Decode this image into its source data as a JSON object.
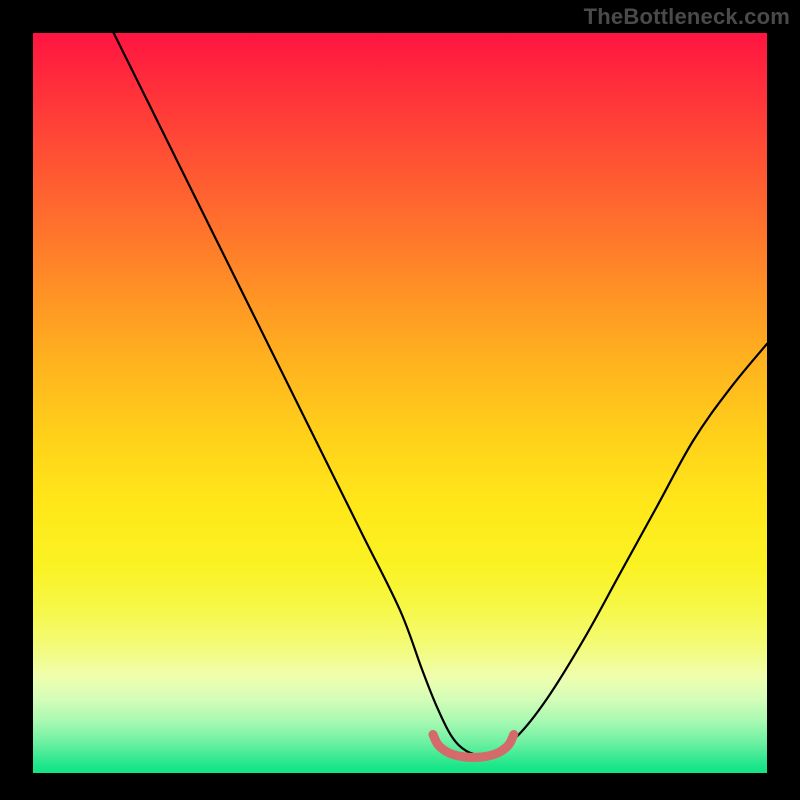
{
  "watermark": "TheBottleneck.com",
  "chart_data": {
    "type": "line",
    "title": "",
    "xlabel": "",
    "ylabel": "",
    "xlim": [
      0,
      100
    ],
    "ylim": [
      0,
      100
    ],
    "grid": false,
    "series": [
      {
        "name": "bottleneck-curve",
        "color": "#000000",
        "x": [
          11,
          15,
          20,
          25,
          30,
          35,
          40,
          45,
          50,
          53,
          55,
          57,
          59,
          61,
          63,
          66,
          70,
          75,
          80,
          85,
          90,
          95,
          100
        ],
        "y": [
          100,
          92,
          82,
          72,
          62,
          52,
          42,
          32,
          22,
          14,
          9,
          5,
          3,
          2.5,
          3,
          5,
          10,
          18,
          27,
          36,
          45,
          52,
          58
        ]
      },
      {
        "name": "valley-marker",
        "color": "#d46a6a",
        "x": [
          54.5,
          55.2,
          56.5,
          58,
          60,
          62,
          63.5,
          64.8,
          65.5
        ],
        "y": [
          5.2,
          3.8,
          2.8,
          2.3,
          2.1,
          2.3,
          2.8,
          3.8,
          5.2
        ]
      }
    ],
    "gradient_stops": [
      {
        "pos": 0,
        "color": "#ff1440"
      },
      {
        "pos": 14,
        "color": "#ff4736"
      },
      {
        "pos": 34,
        "color": "#ff8e26"
      },
      {
        "pos": 55,
        "color": "#ffd21a"
      },
      {
        "pos": 78,
        "color": "#f6f84a"
      },
      {
        "pos": 90,
        "color": "#d4fdb8"
      },
      {
        "pos": 100,
        "color": "#0fe484"
      }
    ]
  }
}
